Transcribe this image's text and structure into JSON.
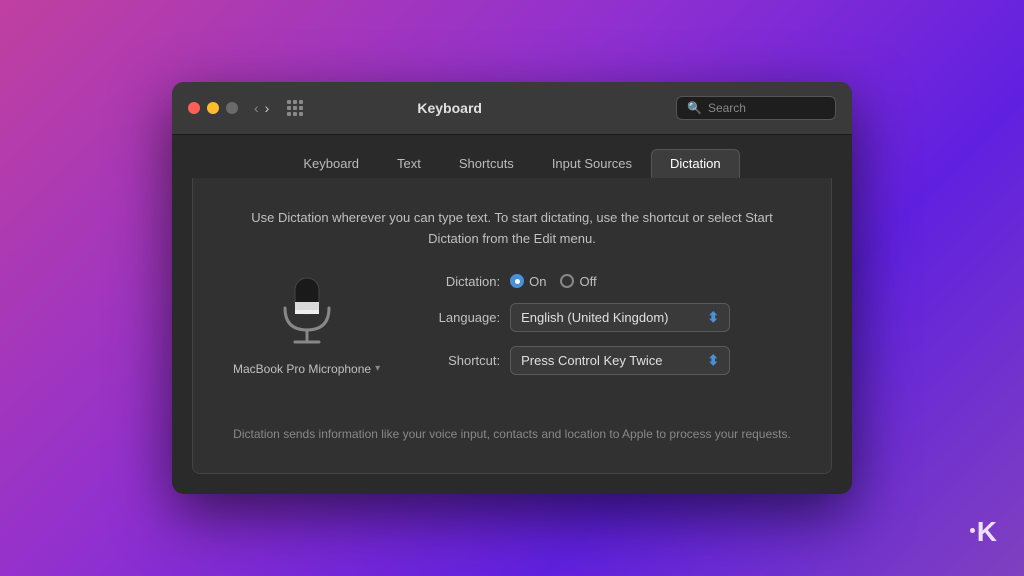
{
  "background": {
    "gradient_start": "#c040a0",
    "gradient_end": "#6020e0"
  },
  "window": {
    "title": "Keyboard"
  },
  "titlebar": {
    "traffic_lights": [
      "red",
      "yellow",
      "gray"
    ],
    "nav_back": "‹",
    "nav_forward": "›",
    "search_placeholder": "Search"
  },
  "tabs": [
    {
      "id": "keyboard",
      "label": "Keyboard",
      "active": false
    },
    {
      "id": "text",
      "label": "Text",
      "active": false
    },
    {
      "id": "shortcuts",
      "label": "Shortcuts",
      "active": false
    },
    {
      "id": "input-sources",
      "label": "Input Sources",
      "active": false
    },
    {
      "id": "dictation",
      "label": "Dictation",
      "active": true
    }
  ],
  "content": {
    "description": "Use Dictation wherever you can type text. To start dictating,\nuse the shortcut or select Start Dictation from the Edit menu.",
    "mic_label": "MacBook Pro Microphone",
    "settings": {
      "dictation": {
        "label": "Dictation:",
        "on_label": "On",
        "off_label": "Off",
        "selected": "on"
      },
      "language": {
        "label": "Language:",
        "value": "English (United Kingdom)"
      },
      "shortcut": {
        "label": "Shortcut:",
        "value": "Press Control Key Twice"
      }
    },
    "footer_note": "Dictation sends information like your voice input, contacts and\nlocation to Apple to process your requests."
  },
  "knowtechie": {
    "badge": "·K"
  }
}
